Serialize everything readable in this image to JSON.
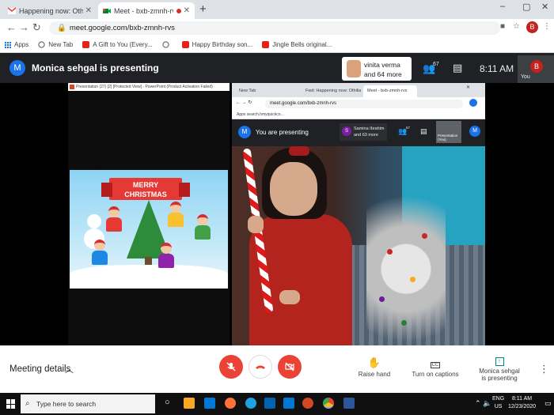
{
  "browser": {
    "tabs": [
      {
        "label": "Happening now: Othilia Fernande",
        "favicon": "gmail-icon"
      },
      {
        "label": "Meet - bxb-zmnh-rvs",
        "favicon": "meet-icon",
        "active": true
      }
    ],
    "new_tab": "+",
    "window_controls": [
      "–",
      "▢",
      "✕"
    ],
    "url": "meet.google.com/bxb-zmnh-rvs",
    "profile_initial": "B",
    "bookmarks": [
      {
        "label": "Apps"
      },
      {
        "label": "New Tab"
      },
      {
        "label": "A Gift to You (Every..."
      },
      {
        "label": ""
      },
      {
        "label": "Happy Birthday son..."
      },
      {
        "label": "Jingle Bells original..."
      }
    ]
  },
  "meet": {
    "header": {
      "avatar_initial": "M",
      "title": "Monica sehgal is presenting",
      "presenter_box": {
        "line1": "vinita verma",
        "line2": "and 64 more"
      },
      "people_count": "67",
      "time": "8:11 AM",
      "self_initial": "B",
      "self_label": "You"
    },
    "ppt_title": "Presentation (27) [2] [Protected View] - PowerPoint (Product Activation Failed)",
    "slide": {
      "banner_line1": "MERRY",
      "banner_line2": "CHRISTMAS"
    },
    "nested": {
      "tabs": [
        "New Tab",
        "Fwd: Happening now: Othilia",
        "Meet - bxb-zmnh-rvs"
      ],
      "url": "meet.google.com/bxb-zmnh-rvs",
      "bookmark": "Apps   search.hmyquickco...",
      "avatar_initial": "M",
      "title": "You are presenting",
      "presenter_initial": "S",
      "presenter_line1": "Samina Ibrahim",
      "presenter_line2": "and 63 more",
      "people_count": "67",
      "present_label_1": "Presentation",
      "present_label_2": "(You)",
      "self_initial": "M",
      "self_label": "You"
    },
    "controls": {
      "meeting_details": "Meeting details",
      "raise_hand": "Raise hand",
      "captions": "Turn on captions",
      "presenting_line1": "Monica sehgal",
      "presenting_line2": "is presenting"
    }
  },
  "taskbar": {
    "search_placeholder": "Type here to search",
    "lang_1": "ENG",
    "lang_2": "US",
    "time": "8:11 AM",
    "date": "12/23/2020"
  },
  "colors": {
    "meet_red": "#ea4335",
    "meet_blue": "#1a73e8",
    "dark_bg": "#202124"
  }
}
